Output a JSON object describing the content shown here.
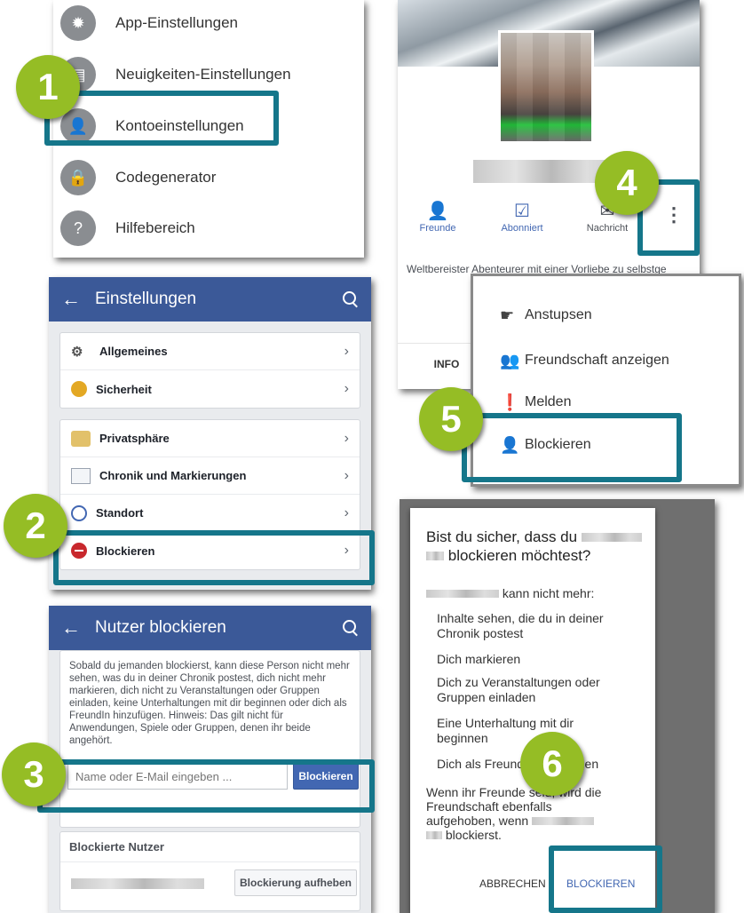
{
  "panel1": {
    "items": [
      {
        "label": "App-Einstellungen",
        "icon": "gear-icon"
      },
      {
        "label": "Neuigkeiten-Einstellungen",
        "icon": "newsfeed-icon"
      },
      {
        "label": "Kontoeinstellungen",
        "icon": "account-icon"
      },
      {
        "label": "Codegenerator",
        "icon": "lock-icon"
      },
      {
        "label": "Hilfebereich",
        "icon": "help-icon"
      }
    ]
  },
  "panel2": {
    "title": "Einstellungen",
    "group1": [
      {
        "label": "Allgemeines",
        "icon": "gears-icon"
      },
      {
        "label": "Sicherheit",
        "icon": "badge-icon"
      }
    ],
    "group2": [
      {
        "label": "Privatsphäre",
        "icon": "padlock-icon"
      },
      {
        "label": "Chronik und Markierungen",
        "icon": "timeline-icon"
      },
      {
        "label": "Standort",
        "icon": "compass-icon"
      },
      {
        "label": "Blockieren",
        "icon": "block-icon"
      }
    ]
  },
  "panel3": {
    "title": "Nutzer blockieren",
    "description": "Sobald du jemanden blockierst, kann diese Person nicht mehr sehen, was du in deiner Chronik postest, dich nicht mehr markieren, dich nicht zu Veranstaltungen oder Gruppen einladen, keine Unterhaltungen mit dir beginnen oder dich als FreundIn hinzufügen. Hinweis: Das gilt nicht für Anwendungen, Spiele oder Gruppen, denen ihr beide angehört.",
    "input_placeholder": "Name oder E-Mail eingeben ...",
    "block_button": "Blockieren",
    "blocked_heading": "Blockierte Nutzer",
    "unblock_button": "Blockierung aufheben"
  },
  "panel4": {
    "actions": [
      {
        "label": "Freunde",
        "icon": "friends-icon"
      },
      {
        "label": "Abonniert",
        "icon": "subscribed-icon"
      },
      {
        "label": "Nachricht",
        "icon": "messenger-icon"
      }
    ],
    "bio": "Weltbereister Abenteurer mit einer Vorliebe zu selbstge",
    "tab": "INFO"
  },
  "panel5": {
    "items": [
      {
        "label": "Anstupsen",
        "icon": "poke-icon"
      },
      {
        "label": "Freundschaft anzeigen",
        "icon": "friendship-icon"
      },
      {
        "label": "Melden",
        "icon": "report-icon"
      },
      {
        "label": "Blockieren",
        "icon": "block-user-icon"
      }
    ]
  },
  "panel6": {
    "question_line1": "Bist du sicher, dass du",
    "question_line2": "blockieren möchtest?",
    "cannot_more": "kann nicht mehr:",
    "list": [
      "Inhalte sehen, die du in deiner Chronik postest",
      "Dich markieren",
      "Dich zu Veranstaltungen oder Gruppen einladen",
      "Eine Unterhaltung mit dir beginnen",
      "Dich als FreundIn hinzufügen"
    ],
    "note_line1": "Wenn ihr Freunde seid, wird die",
    "note_line2": "Freundschaft ebenfalls",
    "note_line3": "aufgehoben, wenn",
    "note_line4": "blockierst.",
    "cancel": "ABBRECHEN",
    "confirm": "BLOCKIEREN"
  },
  "badges": [
    "1",
    "2",
    "3",
    "4",
    "5",
    "6"
  ],
  "colors": {
    "facebook_blue": "#3b5998",
    "highlight": "#15768a",
    "badge": "#95bd25"
  }
}
